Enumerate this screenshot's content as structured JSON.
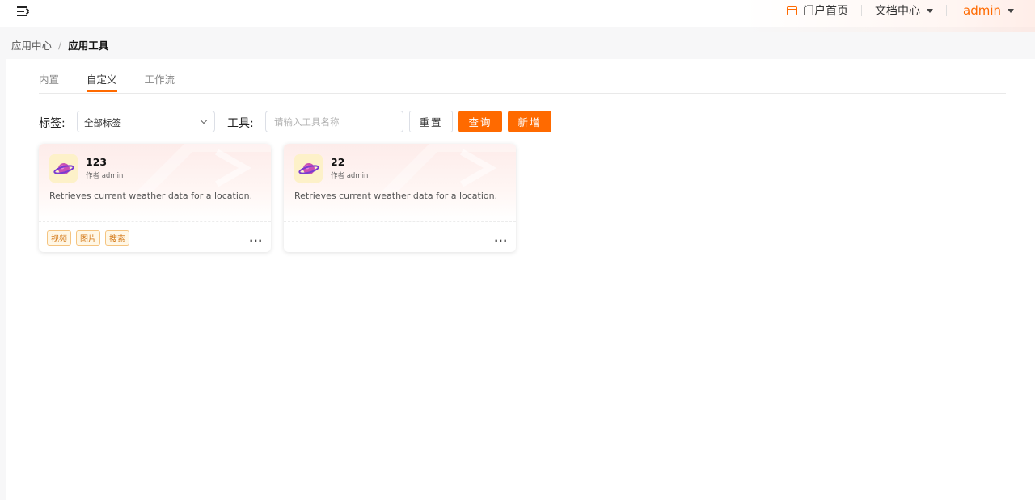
{
  "header": {
    "portal_label": "门户首页",
    "docs_label": "文档中心",
    "user_label": "admin",
    "accent_color": "#ff6a00"
  },
  "breadcrumb": {
    "parent": "应用中心",
    "separator": "/",
    "current": "应用工具"
  },
  "tabs": [
    {
      "label": "内置",
      "active": false
    },
    {
      "label": "自定义",
      "active": true
    },
    {
      "label": "工作流",
      "active": false
    }
  ],
  "filters": {
    "tag_label": "标签:",
    "tag_select_value": "全部标签",
    "tool_label": "工具:",
    "tool_placeholder": "请输入工具名称",
    "reset_label": "重置",
    "query_label": "查询",
    "add_label": "新增"
  },
  "cards": [
    {
      "title": "123",
      "author": "作者 admin",
      "description": "Retrieves current weather data for a location.",
      "tags": [
        "视频",
        "图片",
        "搜索"
      ],
      "more": "..."
    },
    {
      "title": "22",
      "author": "作者 admin",
      "description": "Retrieves current weather data for a location.",
      "tags": [],
      "more": "..."
    }
  ]
}
